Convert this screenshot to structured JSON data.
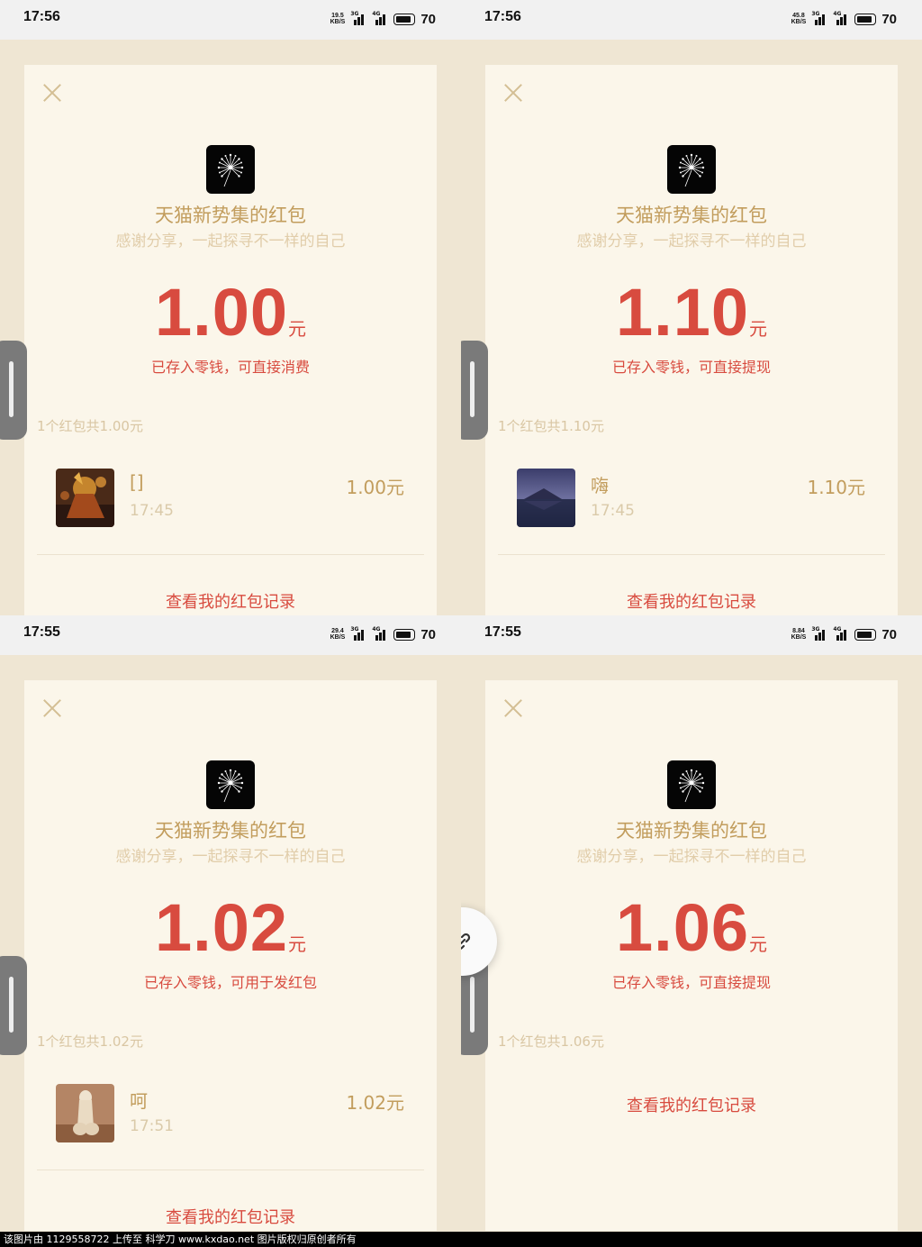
{
  "colors": {
    "page_bg": "#efe6d3",
    "card_bg": "#fbf6ea",
    "accent_red": "#d84b3f",
    "gold_text": "#c29d5d",
    "light_gold_text": "#e1cdaa"
  },
  "panels": [
    {
      "status": {
        "time": "17:56",
        "netspeed_top": "19.5",
        "netspeed_bottom": "KB/S",
        "net1": "3G",
        "net2": "4G",
        "battery": "70"
      },
      "sender": "天猫新势集的红包",
      "greeting": "感谢分享，一起探寻不一样的自己",
      "amount": "1.00",
      "unit": "元",
      "stored_msg": "已存入零钱，可直接消费",
      "summary": "1个红包共1.00元",
      "record": {
        "name": "[]",
        "time": "17:45",
        "amount": "1.00元",
        "avatar": "game-character-avatar"
      },
      "view_records": "查看我的红包记录"
    },
    {
      "status": {
        "time": "17:56",
        "netspeed_top": "45.8",
        "netspeed_bottom": "KB/S",
        "net1": "3G",
        "net2": "4G",
        "battery": "70"
      },
      "sender": "天猫新势集的红包",
      "greeting": "感谢分享，一起探寻不一样的自己",
      "amount": "1.10",
      "unit": "元",
      "stored_msg": "已存入零钱，可直接提现",
      "summary": "1个红包共1.10元",
      "record": {
        "name": "嗨",
        "time": "17:45",
        "amount": "1.10元",
        "avatar": "mountain-lake-avatar"
      },
      "view_records": "查看我的红包记录"
    },
    {
      "status": {
        "time": "17:55",
        "netspeed_top": "29.4",
        "netspeed_bottom": "KB/S",
        "net1": "3G",
        "net2": "4G",
        "battery": "70"
      },
      "sender": "天猫新势集的红包",
      "greeting": "感谢分享，一起探寻不一样的自己",
      "amount": "1.02",
      "unit": "元",
      "stored_msg": "已存入零钱，可用于发红包",
      "summary": "1个红包共1.02元",
      "record": {
        "name": "呵",
        "time": "17:51",
        "amount": "1.02元",
        "avatar": "figurine-avatar"
      },
      "view_records": "查看我的红包记录"
    },
    {
      "status": {
        "time": "17:55",
        "netspeed_top": "8.84",
        "netspeed_bottom": "KB/S",
        "net1": "3G",
        "net2": "4G",
        "battery": "70"
      },
      "sender": "天猫新势集的红包",
      "greeting": "感谢分享，一起探寻不一样的自己",
      "amount": "1.06",
      "unit": "元",
      "stored_msg": "已存入零钱，可直接提现",
      "summary": "1个红包共1.06元",
      "view_records": "查看我的红包记录"
    }
  ],
  "watermark": "该图片由 1129558722 上传至 科学刀 www.kxdao.net 图片版权归原创者所有"
}
